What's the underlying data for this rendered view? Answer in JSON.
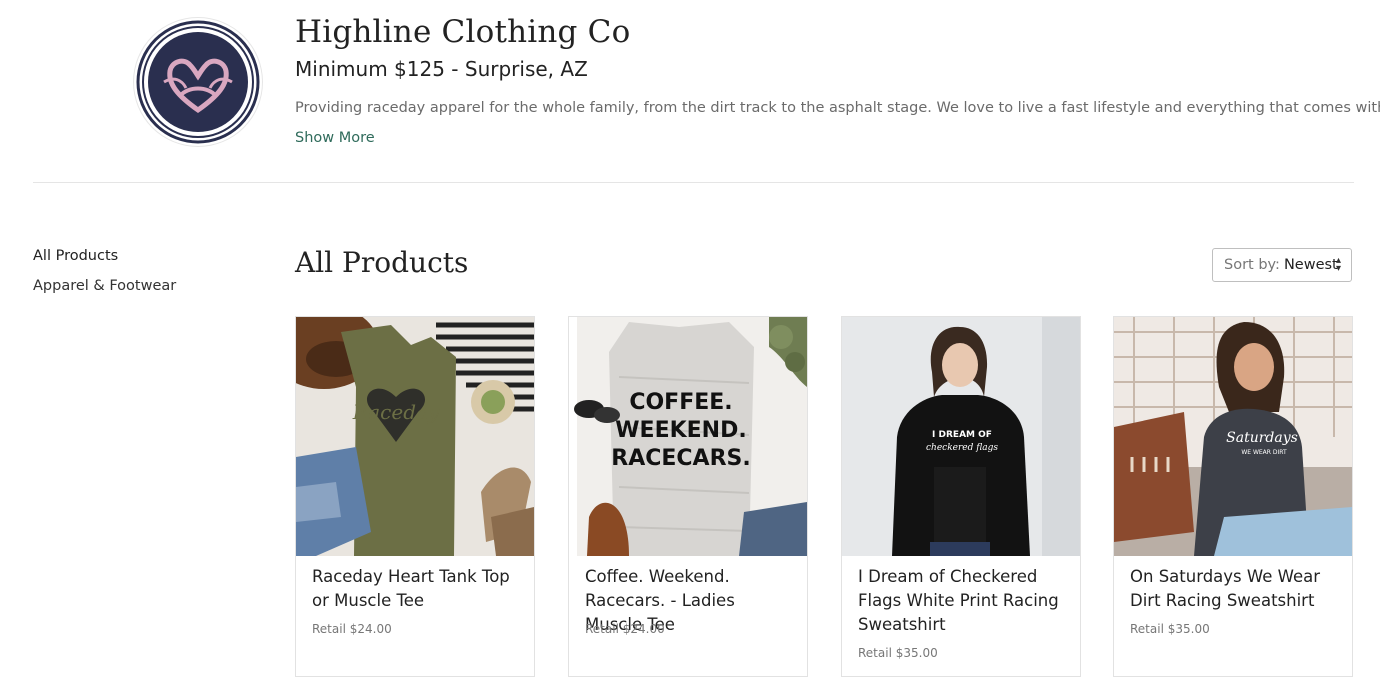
{
  "brand": {
    "name": "Highline Clothing Co",
    "subtitle": "Minimum $125 - Surprise, AZ",
    "description": "Providing raceday apparel for the whole family, from the dirt track to the asphalt stage. We love to live a fast lifestyle and everything that comes with it!",
    "show_more": "Show More",
    "logo_colors": {
      "ring": "#2a2f4f",
      "heart": "#d9a7c0"
    }
  },
  "sidebar": {
    "items": [
      {
        "label": "All Products",
        "active": true
      },
      {
        "label": "Apparel & Footwear",
        "active": false
      }
    ]
  },
  "main": {
    "heading": "All Products",
    "sort": {
      "label": "Sort by:",
      "value": "Newest"
    }
  },
  "products": [
    {
      "title": "Raceday Heart Tank Top or Muscle Tee",
      "price": "Retail $24.00",
      "image": "olive-raceday-tank-flatlay"
    },
    {
      "title": "Coffee. Weekend. Racecars. - Ladies Muscle Tee",
      "price": "Retail $24.00",
      "image": "white-marble-muscle-tee-flatlay"
    },
    {
      "title": "I Dream of Checkered Flags White Print Racing Sweatshirt",
      "price": "Retail $35.00",
      "image": "black-sweatshirt-model"
    },
    {
      "title": "On Saturdays We Wear Dirt Racing Sweatshirt",
      "price": "Retail $35.00",
      "image": "charcoal-sweatshirt-model"
    }
  ],
  "colors": {
    "accent_link": "#2f6b5b",
    "text": "#222222",
    "muted": "#6b6b6b"
  }
}
